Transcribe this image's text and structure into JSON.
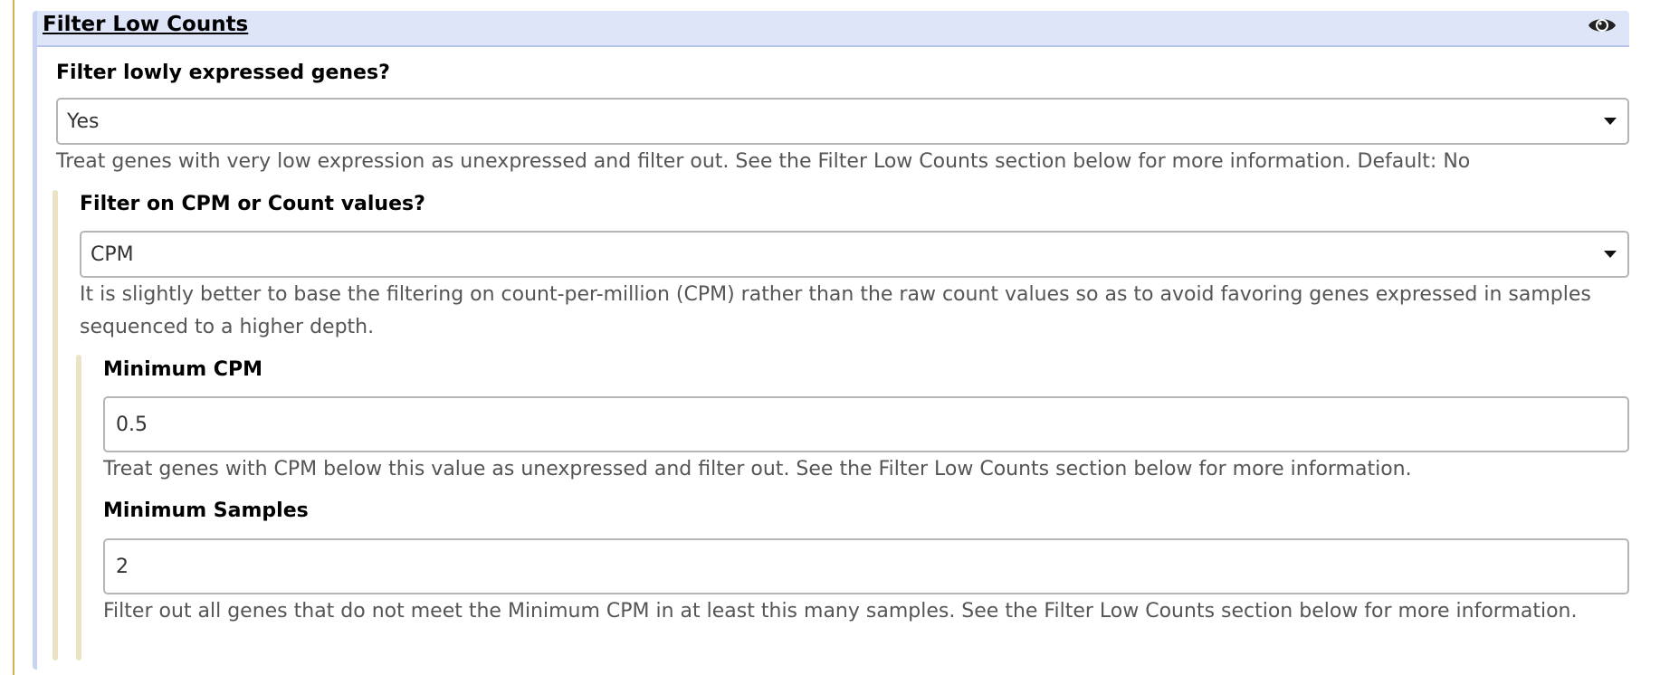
{
  "section": {
    "title": "Filter Low Counts",
    "visibility_icon": "eye-icon"
  },
  "filter_lowly": {
    "label": "Filter lowly expressed genes?",
    "value": "Yes",
    "help": "Treat genes with very low expression as unexpressed and filter out. See the Filter Low Counts section below for more information. Default: No"
  },
  "filter_on": {
    "label": "Filter on CPM or Count values?",
    "value": "CPM",
    "help": "It is slightly better to base the filtering on count-per-million (CPM) rather than the raw count values so as to avoid favoring genes expressed in samples sequenced to a higher depth."
  },
  "minimum_cpm": {
    "label": "Minimum CPM",
    "value": "0.5",
    "help": "Treat genes with CPM below this value as unexpressed and filter out. See the Filter Low Counts section below for more information."
  },
  "minimum_samples": {
    "label": "Minimum Samples",
    "value": "2",
    "help": "Filter out all genes that do not meet the Minimum CPM in at least this many samples. See the Filter Low Counts section below for more information."
  },
  "colors": {
    "header_bg": "#dfe5f9",
    "section_border": "#c9d4f2",
    "outer_border": "#d4b24c",
    "conditional_bar": "#ebe3c5"
  }
}
